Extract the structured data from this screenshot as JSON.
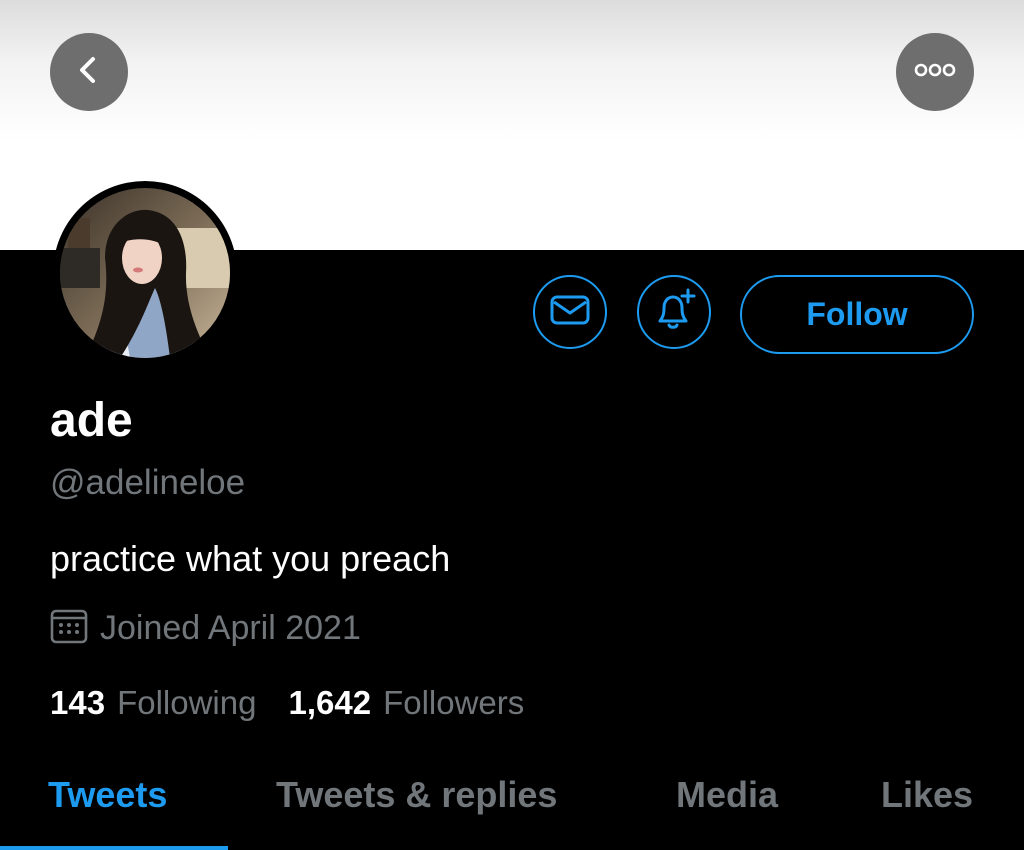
{
  "header": {
    "back_icon": "chevron-left-icon",
    "more_icon": "more-horizontal-icon"
  },
  "actions": {
    "message_icon": "mail-icon",
    "notify_icon": "bell-plus-icon",
    "follow_label": "Follow"
  },
  "profile": {
    "display_name": "ade",
    "handle": "@adelineloe",
    "bio": "practice what you preach",
    "joined_icon": "calendar-icon",
    "joined": "Joined April 2021",
    "following_count": "143",
    "following_label": "Following",
    "followers_count": "1,642",
    "followers_label": "Followers"
  },
  "tabs": [
    {
      "label": "Tweets",
      "active": true
    },
    {
      "label": "Tweets & replies",
      "active": false
    },
    {
      "label": "Media",
      "active": false
    },
    {
      "label": "Likes",
      "active": false
    }
  ],
  "colors": {
    "accent": "#1d9bf0",
    "muted": "#71767b",
    "background": "#000000",
    "text": "#ffffff"
  }
}
